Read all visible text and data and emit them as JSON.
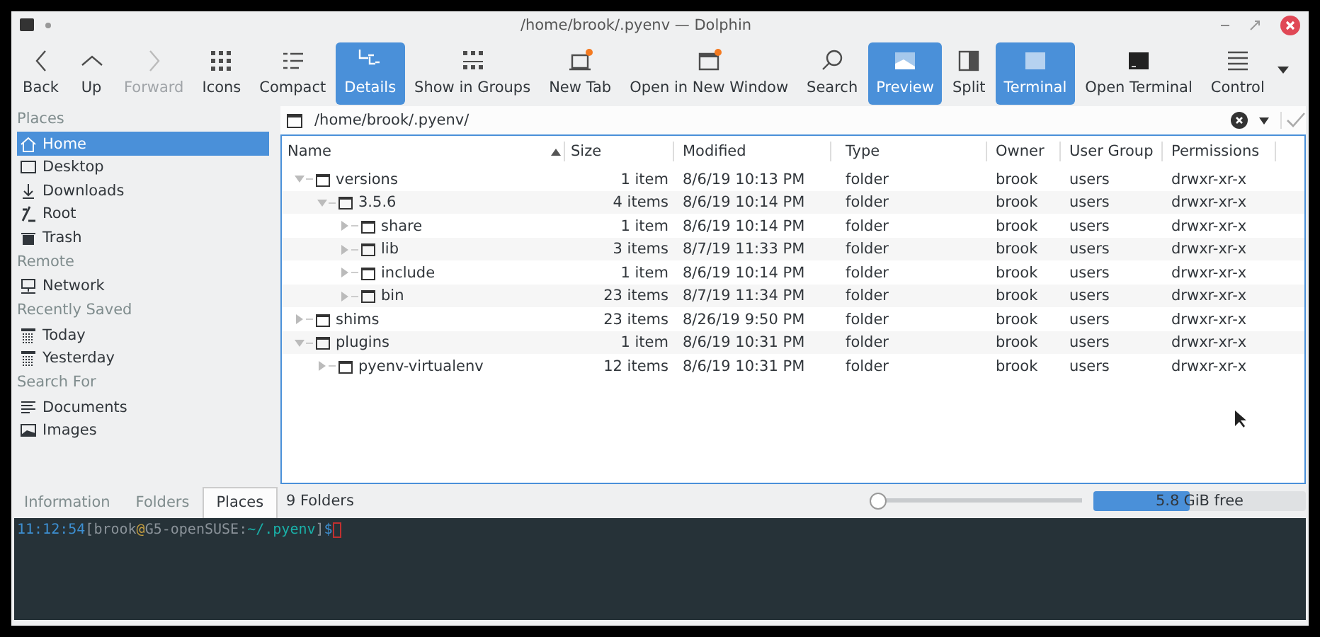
{
  "window": {
    "title": "/home/brook/.pyenv — Dolphin"
  },
  "toolbar": [
    {
      "label": "Back",
      "selected": false,
      "disabled": false
    },
    {
      "label": "Up",
      "selected": false,
      "disabled": false
    },
    {
      "label": "Forward",
      "selected": false,
      "disabled": true
    },
    {
      "label": "Icons",
      "selected": false,
      "disabled": false
    },
    {
      "label": "Compact",
      "selected": false,
      "disabled": false
    },
    {
      "label": "Details",
      "selected": true,
      "disabled": false
    },
    {
      "label": "Show in Groups",
      "selected": false,
      "disabled": false
    },
    {
      "label": "New Tab",
      "selected": false,
      "disabled": false
    },
    {
      "label": "Open in New Window",
      "selected": false,
      "disabled": false
    },
    {
      "label": "Search",
      "selected": false,
      "disabled": false
    },
    {
      "label": "Preview",
      "selected": true,
      "disabled": false
    },
    {
      "label": "Split",
      "selected": false,
      "disabled": false
    },
    {
      "label": "Terminal",
      "selected": true,
      "disabled": false
    },
    {
      "label": "Open Terminal",
      "selected": false,
      "disabled": false
    },
    {
      "label": "Control",
      "selected": false,
      "disabled": false
    }
  ],
  "sidebar": {
    "sections": [
      {
        "title": "Places",
        "items": [
          {
            "label": "Home",
            "selected": true
          },
          {
            "label": "Desktop",
            "selected": false
          },
          {
            "label": "Downloads",
            "selected": false
          },
          {
            "label": "Root",
            "selected": false
          },
          {
            "label": "Trash",
            "selected": false
          }
        ]
      },
      {
        "title": "Remote",
        "items": [
          {
            "label": "Network",
            "selected": false
          }
        ]
      },
      {
        "title": "Recently Saved",
        "items": [
          {
            "label": "Today",
            "selected": false
          },
          {
            "label": "Yesterday",
            "selected": false
          }
        ]
      },
      {
        "title": "Search For",
        "items": [
          {
            "label": "Documents",
            "selected": false
          },
          {
            "label": "Images",
            "selected": false
          }
        ]
      }
    ],
    "tabs": [
      {
        "label": "Information",
        "selected": false
      },
      {
        "label": "Folders",
        "selected": false
      },
      {
        "label": "Places",
        "selected": true
      }
    ]
  },
  "location": {
    "path": "/home/brook/.pyenv/"
  },
  "table": {
    "columns": [
      "Name",
      "Size",
      "Modified",
      "Type",
      "Owner",
      "User Group",
      "Permissions"
    ],
    "rows": [
      {
        "name": "versions",
        "size": "1 item",
        "modified": "8/6/19 10:13 PM",
        "type": "folder",
        "owner": "brook",
        "group": "users",
        "permissions": "drwxr-xr-x",
        "expanded": true,
        "children": [
          {
            "name": "3.5.6",
            "size": "4 items",
            "modified": "8/6/19 10:14 PM",
            "type": "folder",
            "owner": "brook",
            "group": "users",
            "permissions": "drwxr-xr-x",
            "expanded": true,
            "children": [
              {
                "name": "share",
                "size": "1 item",
                "modified": "8/6/19 10:14 PM",
                "type": "folder",
                "owner": "brook",
                "group": "users",
                "permissions": "drwxr-xr-x",
                "expanded": false
              },
              {
                "name": "lib",
                "size": "3 items",
                "modified": "8/7/19 11:33 PM",
                "type": "folder",
                "owner": "brook",
                "group": "users",
                "permissions": "drwxr-xr-x",
                "expanded": false
              },
              {
                "name": "include",
                "size": "1 item",
                "modified": "8/6/19 10:14 PM",
                "type": "folder",
                "owner": "brook",
                "group": "users",
                "permissions": "drwxr-xr-x",
                "expanded": false
              },
              {
                "name": "bin",
                "size": "23 items",
                "modified": "8/7/19 11:34 PM",
                "type": "folder",
                "owner": "brook",
                "group": "users",
                "permissions": "drwxr-xr-x",
                "expanded": false
              }
            ]
          }
        ]
      },
      {
        "name": "shims",
        "size": "23 items",
        "modified": "8/26/19 9:50 PM",
        "type": "folder",
        "owner": "brook",
        "group": "users",
        "permissions": "drwxr-xr-x",
        "expanded": false
      },
      {
        "name": "plugins",
        "size": "1 item",
        "modified": "8/6/19 10:31 PM",
        "type": "folder",
        "owner": "brook",
        "group": "users",
        "permissions": "drwxr-xr-x",
        "expanded": true,
        "children": [
          {
            "name": "pyenv-virtualenv",
            "size": "12 items",
            "modified": "8/6/19 10:31 PM",
            "type": "folder",
            "owner": "brook",
            "group": "users",
            "permissions": "drwxr-xr-x",
            "expanded": false
          }
        ]
      }
    ]
  },
  "status_bar": {
    "text": "9 Folders",
    "zoom": {
      "level": 0
    },
    "free_space": {
      "amount": "5.8",
      "unit": "GiB free",
      "level": 0.45
    }
  },
  "terminal": {
    "prompt": [
      {
        "text": "11:12:54",
        "color": "#3d8fd1"
      },
      {
        "text": "[brook",
        "color": "#8a9299"
      },
      {
        "text": "@",
        "color": "#c8a040"
      },
      {
        "text": "G5-openSUSE",
        "color": "#8a9299"
      },
      {
        "text": ":",
        "color": "#8a9299"
      },
      {
        "text": "~/.pyenv",
        "color": "#1ab0a8"
      },
      {
        "text": "]",
        "color": "#8a9299"
      },
      {
        "text": "$",
        "color": "#3d8fd1"
      }
    ]
  }
}
